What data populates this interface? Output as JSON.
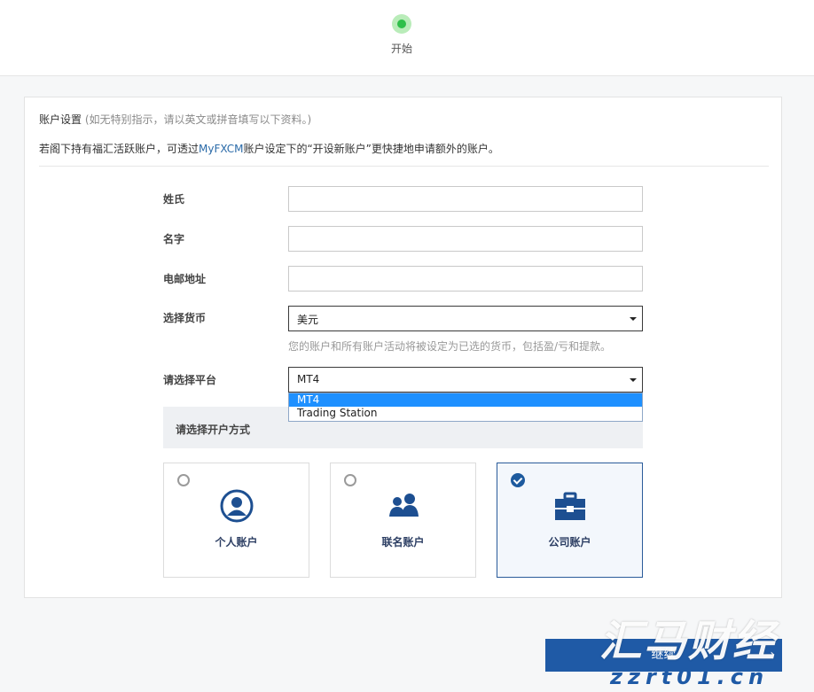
{
  "progress": {
    "step_label": "开始"
  },
  "intro": {
    "title": "账户设置",
    "title_note": " (如无特别指示，请以英文或拼音填写以下资料。)",
    "line2_before": "若阁下持有福汇活跃账户，可透过",
    "line2_link": "MyFXCM",
    "line2_after": "账户设定下的“开设新账户”更快捷地申请额外的账户。"
  },
  "form": {
    "last_name_label": "姓氏",
    "last_name_value": "",
    "first_name_label": "名字",
    "first_name_value": "",
    "email_label": "电邮地址",
    "email_value": "",
    "currency_label": "选择货币",
    "currency_value": "美元",
    "currency_hint": "您的账户和所有账户活动将被设定为已选的货币，包括盈/亏和提款。",
    "platform_label": "请选择平台",
    "platform_value": "MT4",
    "platform_options": [
      "MT4",
      "Trading Station"
    ]
  },
  "account_type": {
    "section_title": "请选择开户方式",
    "options": [
      {
        "label": "个人账户",
        "icon": "person-icon",
        "selected": false
      },
      {
        "label": "联名账户",
        "icon": "two-people-icon",
        "selected": false
      },
      {
        "label": "公司账户",
        "icon": "briefcase-icon",
        "selected": true
      }
    ]
  },
  "actions": {
    "continue_label": "继续",
    "continue_arrow": "›"
  },
  "watermark": {
    "title": "汇马财经",
    "domain": "zzrt01.cn"
  },
  "colors": {
    "accent": "#1f5aa6",
    "step_active": "#2fbf4a",
    "dropdown_highlight": "#1e90ff"
  }
}
